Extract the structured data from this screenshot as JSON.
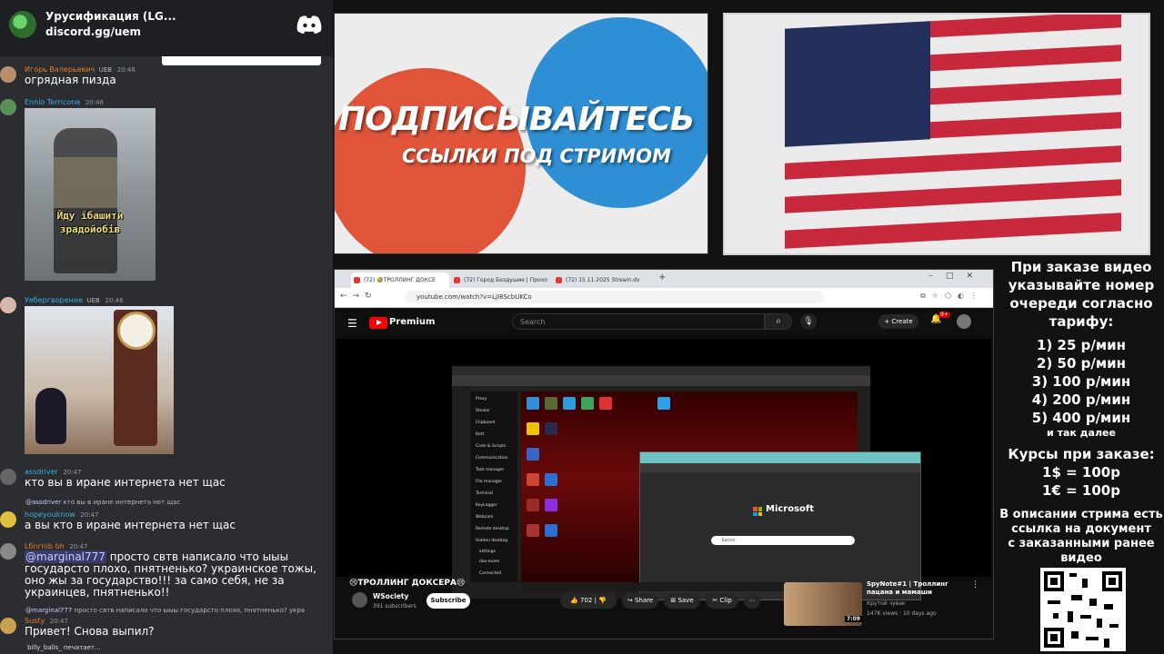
{
  "discord": {
    "server_name": "Урусификация (LG...",
    "server_invite": "discord.gg/uem",
    "messages": [
      {
        "user": "Игорь Валерьевич",
        "badge": "UEB",
        "time": "20:46",
        "text": "огрядная пизда"
      },
      {
        "user": "Ennio Terricone",
        "badge": "",
        "time": "20:46",
        "gif_caption": [
          "Йду їбашити",
          "зрадойобів"
        ]
      },
      {
        "user": "Уебергворение",
        "badge": "UEB",
        "time": "20:46"
      },
      {
        "user": "assdriver",
        "badge": "",
        "time": "20:47",
        "text": "кто вы в иране интернета нет щас"
      },
      {
        "reply_user": "@assdriver",
        "reply_text": "кто вы в иране интернета нет щас"
      },
      {
        "user": "hopeyouknow",
        "badge": "",
        "time": "20:47",
        "text": "а вы кто в иране интернета нет щас"
      },
      {
        "user": "Lбnгnib bh",
        "badge": "",
        "time": "20:47",
        "mention": "@marginal777",
        "text": " просто свтв написало что ыыы государсто плохо, пнятненько? украинское тожы, оно жы за государство!!! за само себя, не за украинцев, пнятненько!!"
      },
      {
        "reply_user": "@marginal777",
        "reply_text": "просто свтв написало что ыыы государсто плохо, пнятненько? укра"
      },
      {
        "user": "Susty",
        "badge": "",
        "time": "20:47",
        "text": "Привет! Снова выпил?"
      }
    ],
    "typing": "billy_balls_ печатает..."
  },
  "promo": {
    "title": "ПОДПИСЫВАЙТЕСЬ",
    "subtitle": "ССЫЛКИ ПОД СТРИМОМ"
  },
  "browser": {
    "tabs": [
      "(72) 🤣ТРОЛЛИНГ ДОКСЕ",
      "(72) Город Бездушие | Прохо",
      "(72) 15.11.2025 Stream.dv"
    ],
    "url": "youtube.com/watch?v=LjI8ScbUKCo",
    "youtube": {
      "brand": "Premium",
      "search_placeholder": "Search",
      "create_label": "Create",
      "notif_count": "9+",
      "video_title": "😢ТРОЛЛИНГ ДОКСЕРА😢",
      "channel": "WSociety",
      "subscribers": "391 subscribers",
      "subscribe_label": "Subscribe",
      "likes": "702",
      "share_label": "Share",
      "save_label": "Save",
      "clip_label": "Clip",
      "rec_title": "SpyNote#1 | Троллинг пацана и мамаши",
      "rec_channel": "Крутой чувак",
      "rec_meta": "147K views · 10 days ago",
      "rec_duration": "7:09",
      "inner": {
        "sidebar": [
          "Proxy",
          "Stealer",
          "Clipboard",
          "Rott",
          "Code & Scripts",
          "Communication",
          "Task manager",
          "File manager",
          "Terminal",
          "KeyLogger",
          "Webcam",
          "Remote desktop",
          "Hidden desktop",
          "settings",
          "dox-exam",
          "Connected"
        ],
        "ms_brand": "Microsoft",
        "ms_search": "Бесплт"
      }
    }
  },
  "pricing": {
    "intro": [
      "При заказе видео",
      "указывайте номер",
      "очереди согласно",
      "тарифу:"
    ],
    "tiers": [
      "1) 25 р/мин",
      "2) 50 р/мин",
      "3) 100 р/мин",
      "4) 200 р/мин",
      "5) 400 р/мин"
    ],
    "etc": "и так далее",
    "rates_title": "Курсы при заказе:",
    "rates": [
      "1$ = 100р",
      "1€ = 100р"
    ],
    "note": [
      "В описании стрима есть",
      "ссылка на документ",
      "с заказанными ранее",
      "видео"
    ]
  }
}
